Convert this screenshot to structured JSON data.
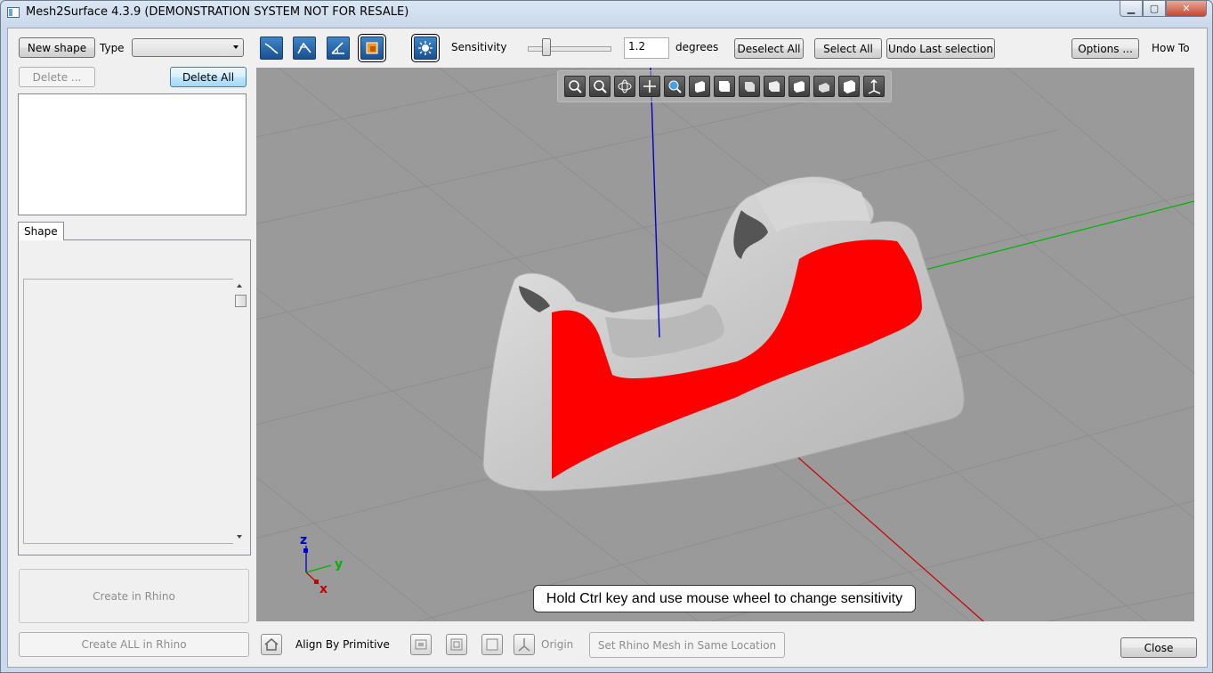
{
  "window": {
    "title": "Mesh2Surface 4.3.9 (DEMONSTRATION SYSTEM NOT FOR RESALE)",
    "min_glyph": "▁",
    "max_glyph": "▢",
    "close_glyph": "✕"
  },
  "toolbar": {
    "new_shape": "New shape",
    "type_label": "Type",
    "type_value": "",
    "tools": [
      {
        "icon": "curve-icon"
      },
      {
        "icon": "polyline-icon"
      },
      {
        "icon": "angle-icon"
      },
      {
        "icon": "region-select-icon",
        "selected": true
      }
    ],
    "magic_icon": "auto-select-icon",
    "sensitivity_label": "Sensitivity",
    "sensitivity_value": "1.2",
    "sensitivity_level": 0.2,
    "degrees_label": "degrees",
    "deselect_all": "Deselect All",
    "select_all": "Select All",
    "undo_last": "Undo Last selection",
    "options": "Options ...",
    "how_to": "How To"
  },
  "left_panel": {
    "delete": "Delete ...",
    "delete_all": "Delete All",
    "tab_shape": "Shape",
    "create_in_rhino": "Create in Rhino",
    "create_all_in_rhino": "Create ALL in Rhino"
  },
  "viewport": {
    "view_tools": [
      "zoom-extents-icon",
      "zoom-window-icon",
      "rotate-icon",
      "pan-icon",
      "zoom-icon",
      "view-front-icon",
      "view-back-icon",
      "view-left-icon",
      "view-right-icon",
      "view-top-icon",
      "view-bottom-icon",
      "view-iso-icon",
      "axes-icon"
    ],
    "hint": "Hold Ctrl key and use mouse wheel to change sensitivity",
    "axis_z": "z",
    "axis_y": "y",
    "axis_x": "x",
    "colors": {
      "background": "#9a9a9a",
      "selection": "#ff0000",
      "mesh": "#c8c8c8",
      "x_axis": "#c80000",
      "y_axis": "#00b400",
      "z_axis": "#0000c8"
    }
  },
  "bottom_bar": {
    "align_by_primitive": "Align By Primitive",
    "origin": "Origin",
    "set_rhino_mesh": "Set Rhino Mesh in Same Location",
    "close": "Close"
  }
}
